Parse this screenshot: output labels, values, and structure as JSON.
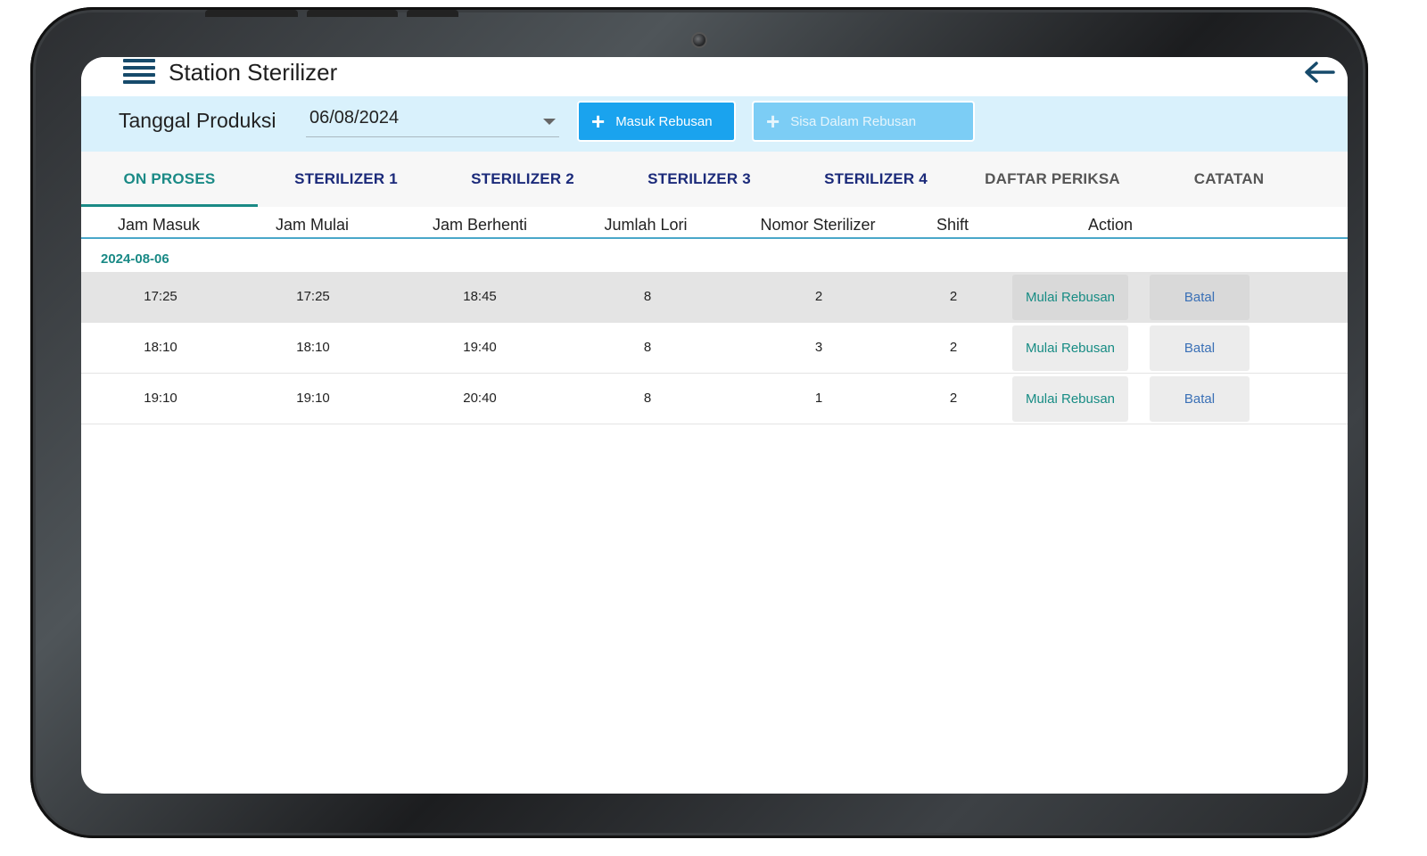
{
  "header": {
    "title": "Station Sterilizer"
  },
  "toolbar": {
    "date_label": "Tanggal Produksi",
    "date_value": "06/08/2024",
    "masuk_label": "Masuk Rebusan",
    "sisa_label": "Sisa Dalam Rebusan"
  },
  "tabs": [
    {
      "label": "ON PROSES"
    },
    {
      "label": "STERILIZER 1"
    },
    {
      "label": "STERILIZER 2"
    },
    {
      "label": "STERILIZER 3"
    },
    {
      "label": "STERILIZER 4"
    },
    {
      "label": "DAFTAR PERIKSA"
    },
    {
      "label": "CATATAN"
    }
  ],
  "table": {
    "columns": [
      "Jam Masuk",
      "Jam Mulai",
      "Jam Berhenti",
      "Jumlah Lori",
      "Nomor Sterilizer",
      "Shift",
      "Action"
    ],
    "group_date": "2024-08-06",
    "rows": [
      {
        "jam_masuk": "17:25",
        "jam_mulai": "17:25",
        "jam_berhenti": "18:45",
        "jumlah_lori": "8",
        "nomor_sterilizer": "2",
        "shift": "2"
      },
      {
        "jam_masuk": "18:10",
        "jam_mulai": "18:10",
        "jam_berhenti": "19:40",
        "jumlah_lori": "8",
        "nomor_sterilizer": "3",
        "shift": "2"
      },
      {
        "jam_masuk": "19:10",
        "jam_mulai": "19:10",
        "jam_berhenti": "20:40",
        "jumlah_lori": "8",
        "nomor_sterilizer": "1",
        "shift": "2"
      }
    ],
    "action_start_label": "Mulai Rebusan",
    "action_cancel_label": "Batal"
  },
  "icons": {
    "menu": "menu-icon",
    "back": "arrow-left-icon",
    "dropdown": "chevron-down-icon",
    "plus": "plus-icon"
  },
  "colors": {
    "accent_teal": "#1a8a86",
    "primary_blue": "#1aa3ee",
    "tab_navy": "#1b2a7a",
    "toolbar_bg": "#d9f1fc"
  }
}
